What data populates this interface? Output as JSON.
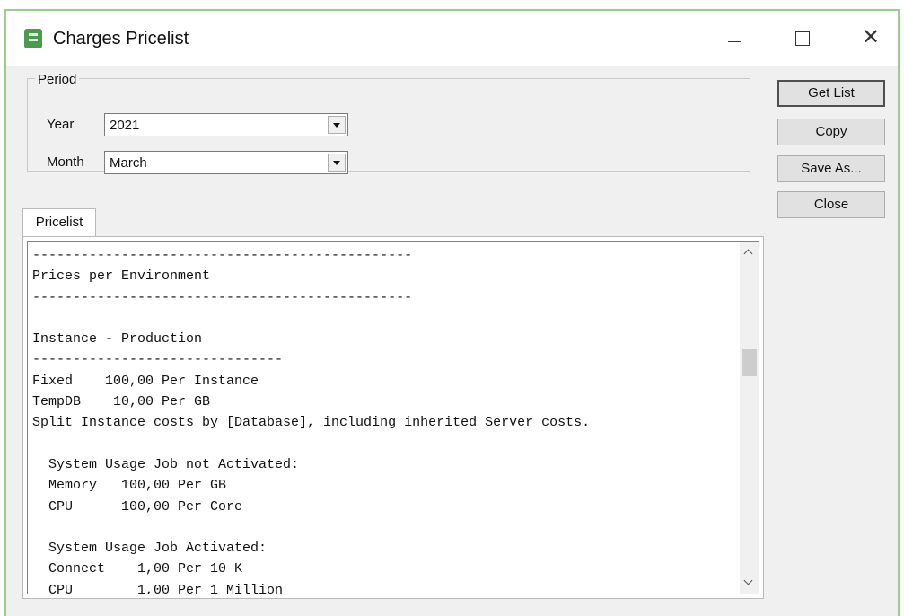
{
  "window": {
    "title": "Charges Pricelist",
    "icon": "pricelist-app-icon"
  },
  "period": {
    "group_label": "Period",
    "year_label": "Year",
    "year_value": "2021",
    "month_label": "Month",
    "month_value": "March"
  },
  "buttons": {
    "get_list": "Get List",
    "copy": "Copy",
    "save_as": "Save As...",
    "close": "Close"
  },
  "tabs": {
    "pricelist": "Pricelist"
  },
  "pricelist_text": "-----------------------------------------------\nPrices per Environment\n-----------------------------------------------\n\nInstance - Production\n-------------------------------\nFixed    100,00 Per Instance\nTempDB    10,00 Per GB\nSplit Instance costs by [Database], including inherited Server costs.\n\n  System Usage Job not Activated:\n  Memory   100,00 Per GB\n  CPU      100,00 Per Core\n\n  System Usage Job Activated:\n  Connect    1,00 Per 10 K\n  CPU        1,00 Per 1 Million"
}
